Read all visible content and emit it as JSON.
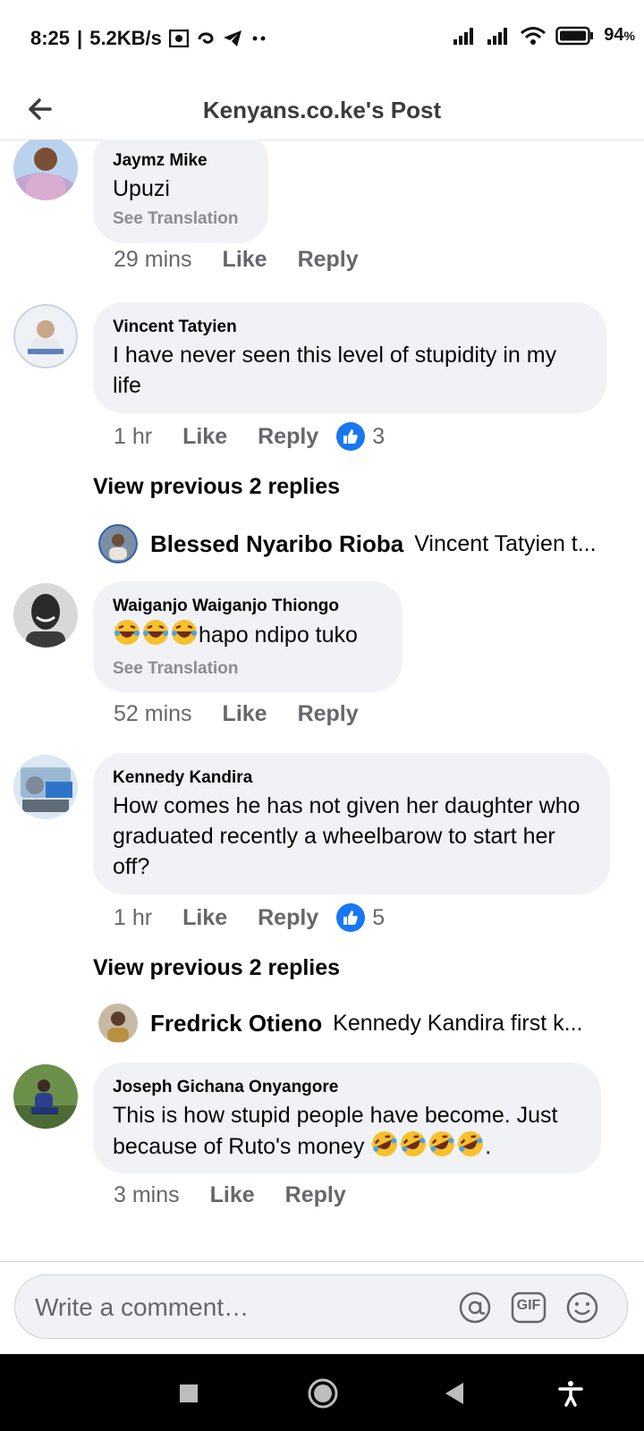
{
  "status_bar": {
    "time": "8:25",
    "speed": "5.2KB/s",
    "battery": "94"
  },
  "header": {
    "title": "Kenyans.co.ke's Post"
  },
  "comments": [
    {
      "author": "Jaymz Mike",
      "text": "Upuzi",
      "see_translation": "See Translation",
      "time": "29 mins",
      "like": "Like",
      "reply": "Reply"
    },
    {
      "author": "Vincent Tatyien",
      "text": "I have never seen this level of stupidity in my life",
      "time": "1 hr",
      "like": "Like",
      "reply": "Reply",
      "reaction_count": "3",
      "view_previous": "View previous 2 replies",
      "reply_preview": {
        "name": "Blessed Nyaribo Rioba",
        "text": "Vincent Tatyien t..."
      }
    },
    {
      "author": "Waiganjo Waiganjo Thiongo",
      "text": "hapo ndipo tuko",
      "emoji_count": 3,
      "see_translation": "See Translation",
      "time": "52 mins",
      "like": "Like",
      "reply": "Reply"
    },
    {
      "author": "Kennedy Kandira",
      "text": "How comes he has not given her daughter who graduated recently a wheelbarow to start her off?",
      "time": "1 hr",
      "like": "Like",
      "reply": "Reply",
      "reaction_count": "5",
      "view_previous": "View previous 2 replies",
      "reply_preview": {
        "name": "Fredrick Otieno",
        "text": "Kennedy Kandira first k..."
      }
    },
    {
      "author": "Joseph Gichana Onyangore",
      "text": "This is how stupid people have become. Just because of Ruto's money",
      "text_suffix": ".",
      "emoji_count": 4,
      "time": "3 mins",
      "like": "Like",
      "reply": "Reply"
    }
  ],
  "composer": {
    "placeholder": "Write a comment…",
    "mention_icon": "at-icon",
    "gif_label": "GIF",
    "emoji_icon": "smiley-icon"
  },
  "colors": {
    "accent": "#1877f2",
    "bubble": "#f0f2f5",
    "muted": "#65676b"
  }
}
